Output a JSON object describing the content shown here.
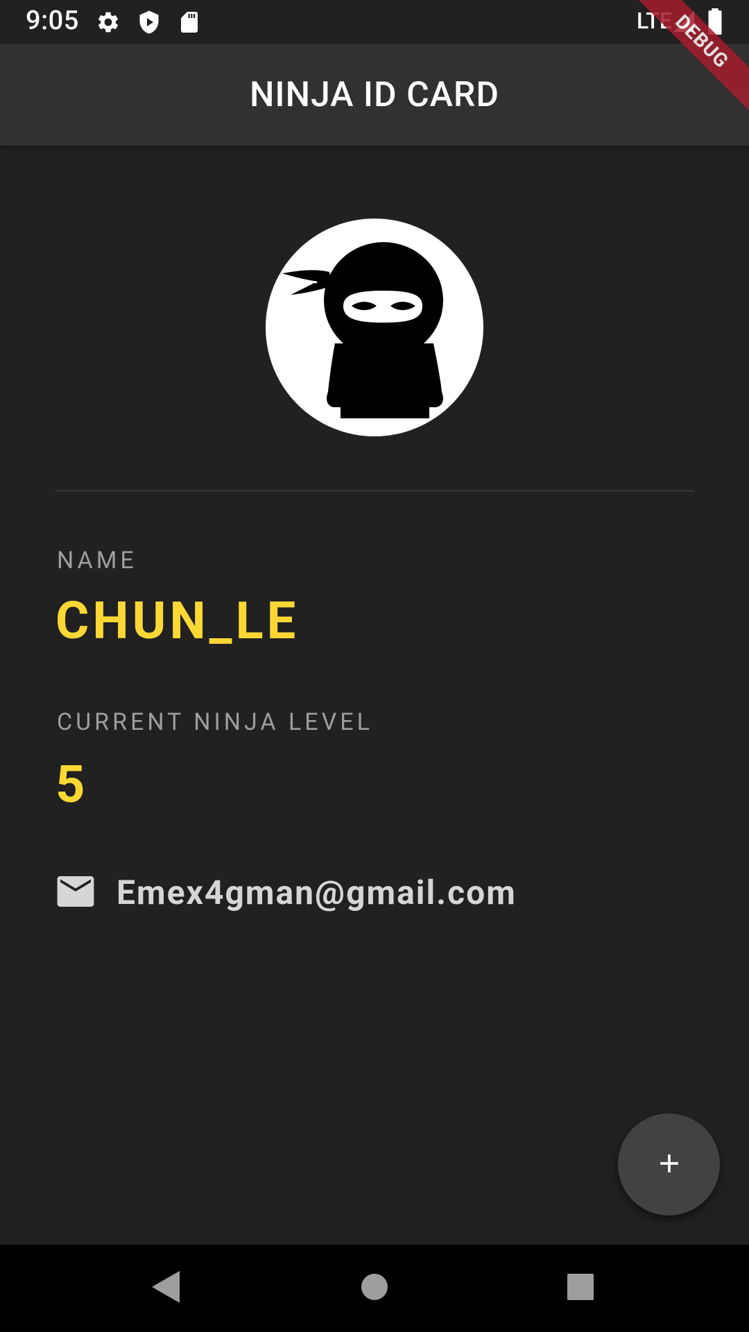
{
  "status_bar": {
    "time": "9:05",
    "network": "LTE",
    "icons": [
      "settings-icon",
      "shield-play-icon",
      "sd-card-icon",
      "signal-icon",
      "battery-icon"
    ]
  },
  "app_bar": {
    "title": "NINJA ID CARD"
  },
  "debug_banner": {
    "label": "DEBUG"
  },
  "profile": {
    "avatar": "ninja-avatar",
    "name_label": "NAME",
    "name_value": "CHUN_LE",
    "level_label": "CURRENT NINJA LEVEL",
    "level_value": "5",
    "email": "Emex4gman@gmail.com",
    "email_icon": "mail-icon"
  },
  "fab": {
    "icon": "plus-icon"
  },
  "nav_bar": {
    "buttons": [
      "back-icon",
      "home-icon",
      "recents-icon"
    ]
  },
  "colors": {
    "background": "#212121",
    "app_bar": "#313131",
    "accent": "#fdd835",
    "label": "#9e9e9e",
    "fab": "#424242"
  }
}
